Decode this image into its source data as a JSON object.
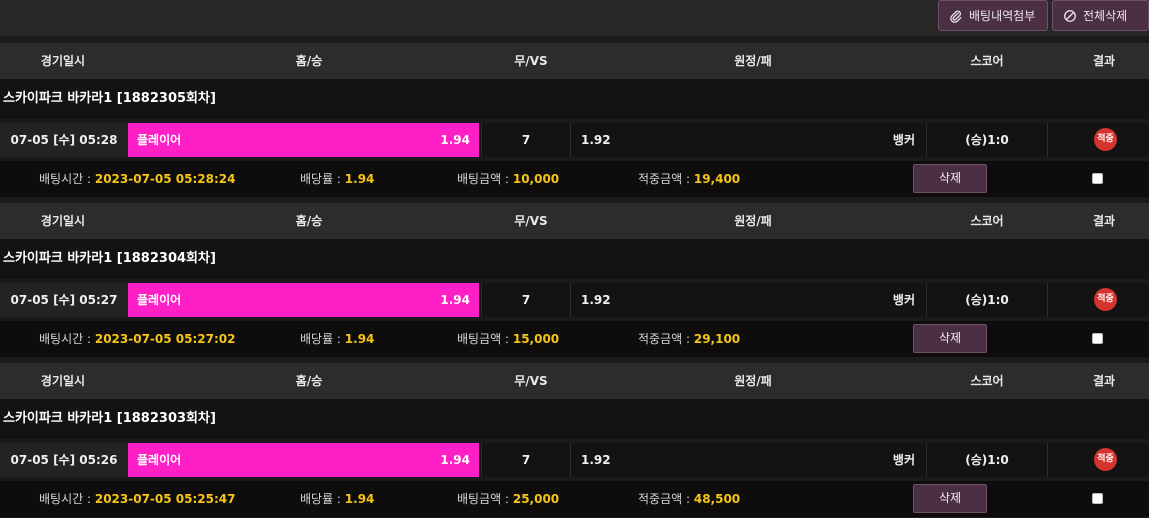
{
  "toolbar": {
    "attach_label": "배팅내역첨부",
    "delete_all_label": "전체삭제"
  },
  "columns": {
    "date": "경기일시",
    "home": "홈/승",
    "draw": "무/VS",
    "away": "원정/패",
    "score": "스코어",
    "result": "결과"
  },
  "bets": [
    {
      "game_title": "스카이파크 바카라1  [1882305회차]",
      "date": "07-05 [수] 05:28",
      "home_label": "플레이어",
      "home_odds": "1.94",
      "draw_value": "7",
      "away_odds": "1.92",
      "away_label": "뱅커",
      "score": "(승)1:0",
      "result_badge": "적중",
      "bet_time_label": "배팅시간 : ",
      "bet_time": "2023-07-05 05:28:24",
      "odds_label": "배당률 : ",
      "odds": "1.94",
      "amount_label": "배팅금액 : ",
      "amount": "10,000",
      "win_label": "적중금액 : ",
      "win_amount": "19,400",
      "delete_label": "삭제"
    },
    {
      "game_title": "스카이파크 바카라1  [1882304회차]",
      "date": "07-05 [수] 05:27",
      "home_label": "플레이어",
      "home_odds": "1.94",
      "draw_value": "7",
      "away_odds": "1.92",
      "away_label": "뱅커",
      "score": "(승)1:0",
      "result_badge": "적중",
      "bet_time_label": "배팅시간 : ",
      "bet_time": "2023-07-05 05:27:02",
      "odds_label": "배당률 : ",
      "odds": "1.94",
      "amount_label": "배팅금액 : ",
      "amount": "15,000",
      "win_label": "적중금액 : ",
      "win_amount": "29,100",
      "delete_label": "삭제"
    },
    {
      "game_title": "스카이파크 바카라1  [1882303회차]",
      "date": "07-05 [수] 05:26",
      "home_label": "플레이어",
      "home_odds": "1.94",
      "draw_value": "7",
      "away_odds": "1.92",
      "away_label": "뱅커",
      "score": "(승)1:0",
      "result_badge": "적중",
      "bet_time_label": "배팅시간 : ",
      "bet_time": "2023-07-05 05:25:47",
      "odds_label": "배당률 : ",
      "odds": "1.94",
      "amount_label": "배팅금액 : ",
      "amount": "25,000",
      "win_label": "적중금액 : ",
      "win_amount": "48,500",
      "delete_label": "삭제"
    }
  ],
  "colors": {
    "home_pick": "#ff1fc7",
    "highlight_value": "#f5c518",
    "win_badge": "#d8342e",
    "button_bg": "#4a2f45"
  },
  "icons": {
    "attach": "paperclip-icon",
    "delete_all": "ban-icon"
  }
}
